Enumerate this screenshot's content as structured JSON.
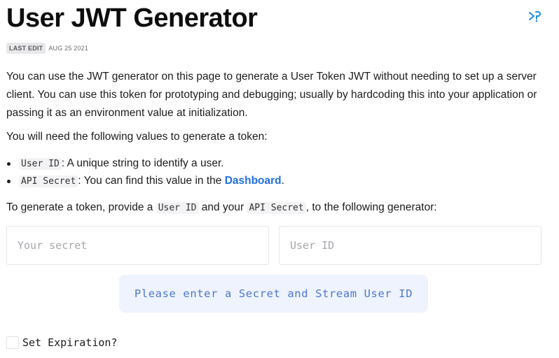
{
  "title": "User JWT Generator",
  "meta": {
    "badge": "LAST EDIT",
    "date": "AUG 25 2021"
  },
  "intro": "You can use the JWT generator on this page to generate a User Token JWT without needing to set up a server client. You can use this token for prototyping and debugging; usually by hardcoding this into your application or passing it as an environment value at initialization.",
  "values_intro": "You will need the following values to generate a token:",
  "bullets": [
    {
      "code": "User ID",
      "text": ": A unique string to identify a user."
    },
    {
      "code": "API Secret",
      "text": ": You can find this value in the ",
      "link": "Dashboard",
      "after": "."
    }
  ],
  "instruction": {
    "before": "To generate a token, provide a ",
    "code1": "User ID",
    "middle": " and your ",
    "code2": "API Secret",
    "after": ", to the following generator:"
  },
  "form": {
    "secret_placeholder": "Your secret",
    "userid_placeholder": "User ID",
    "button_label": "Please enter a Secret and Stream User ID",
    "expiration_label": "Set Expiration?"
  },
  "icons": {
    "top_right": "docs-link-icon"
  },
  "colors": {
    "link": "#1f6fe0",
    "button_bg": "#eef3fd",
    "button_text": "#4f78d0",
    "icon": "#1a8fe0"
  }
}
